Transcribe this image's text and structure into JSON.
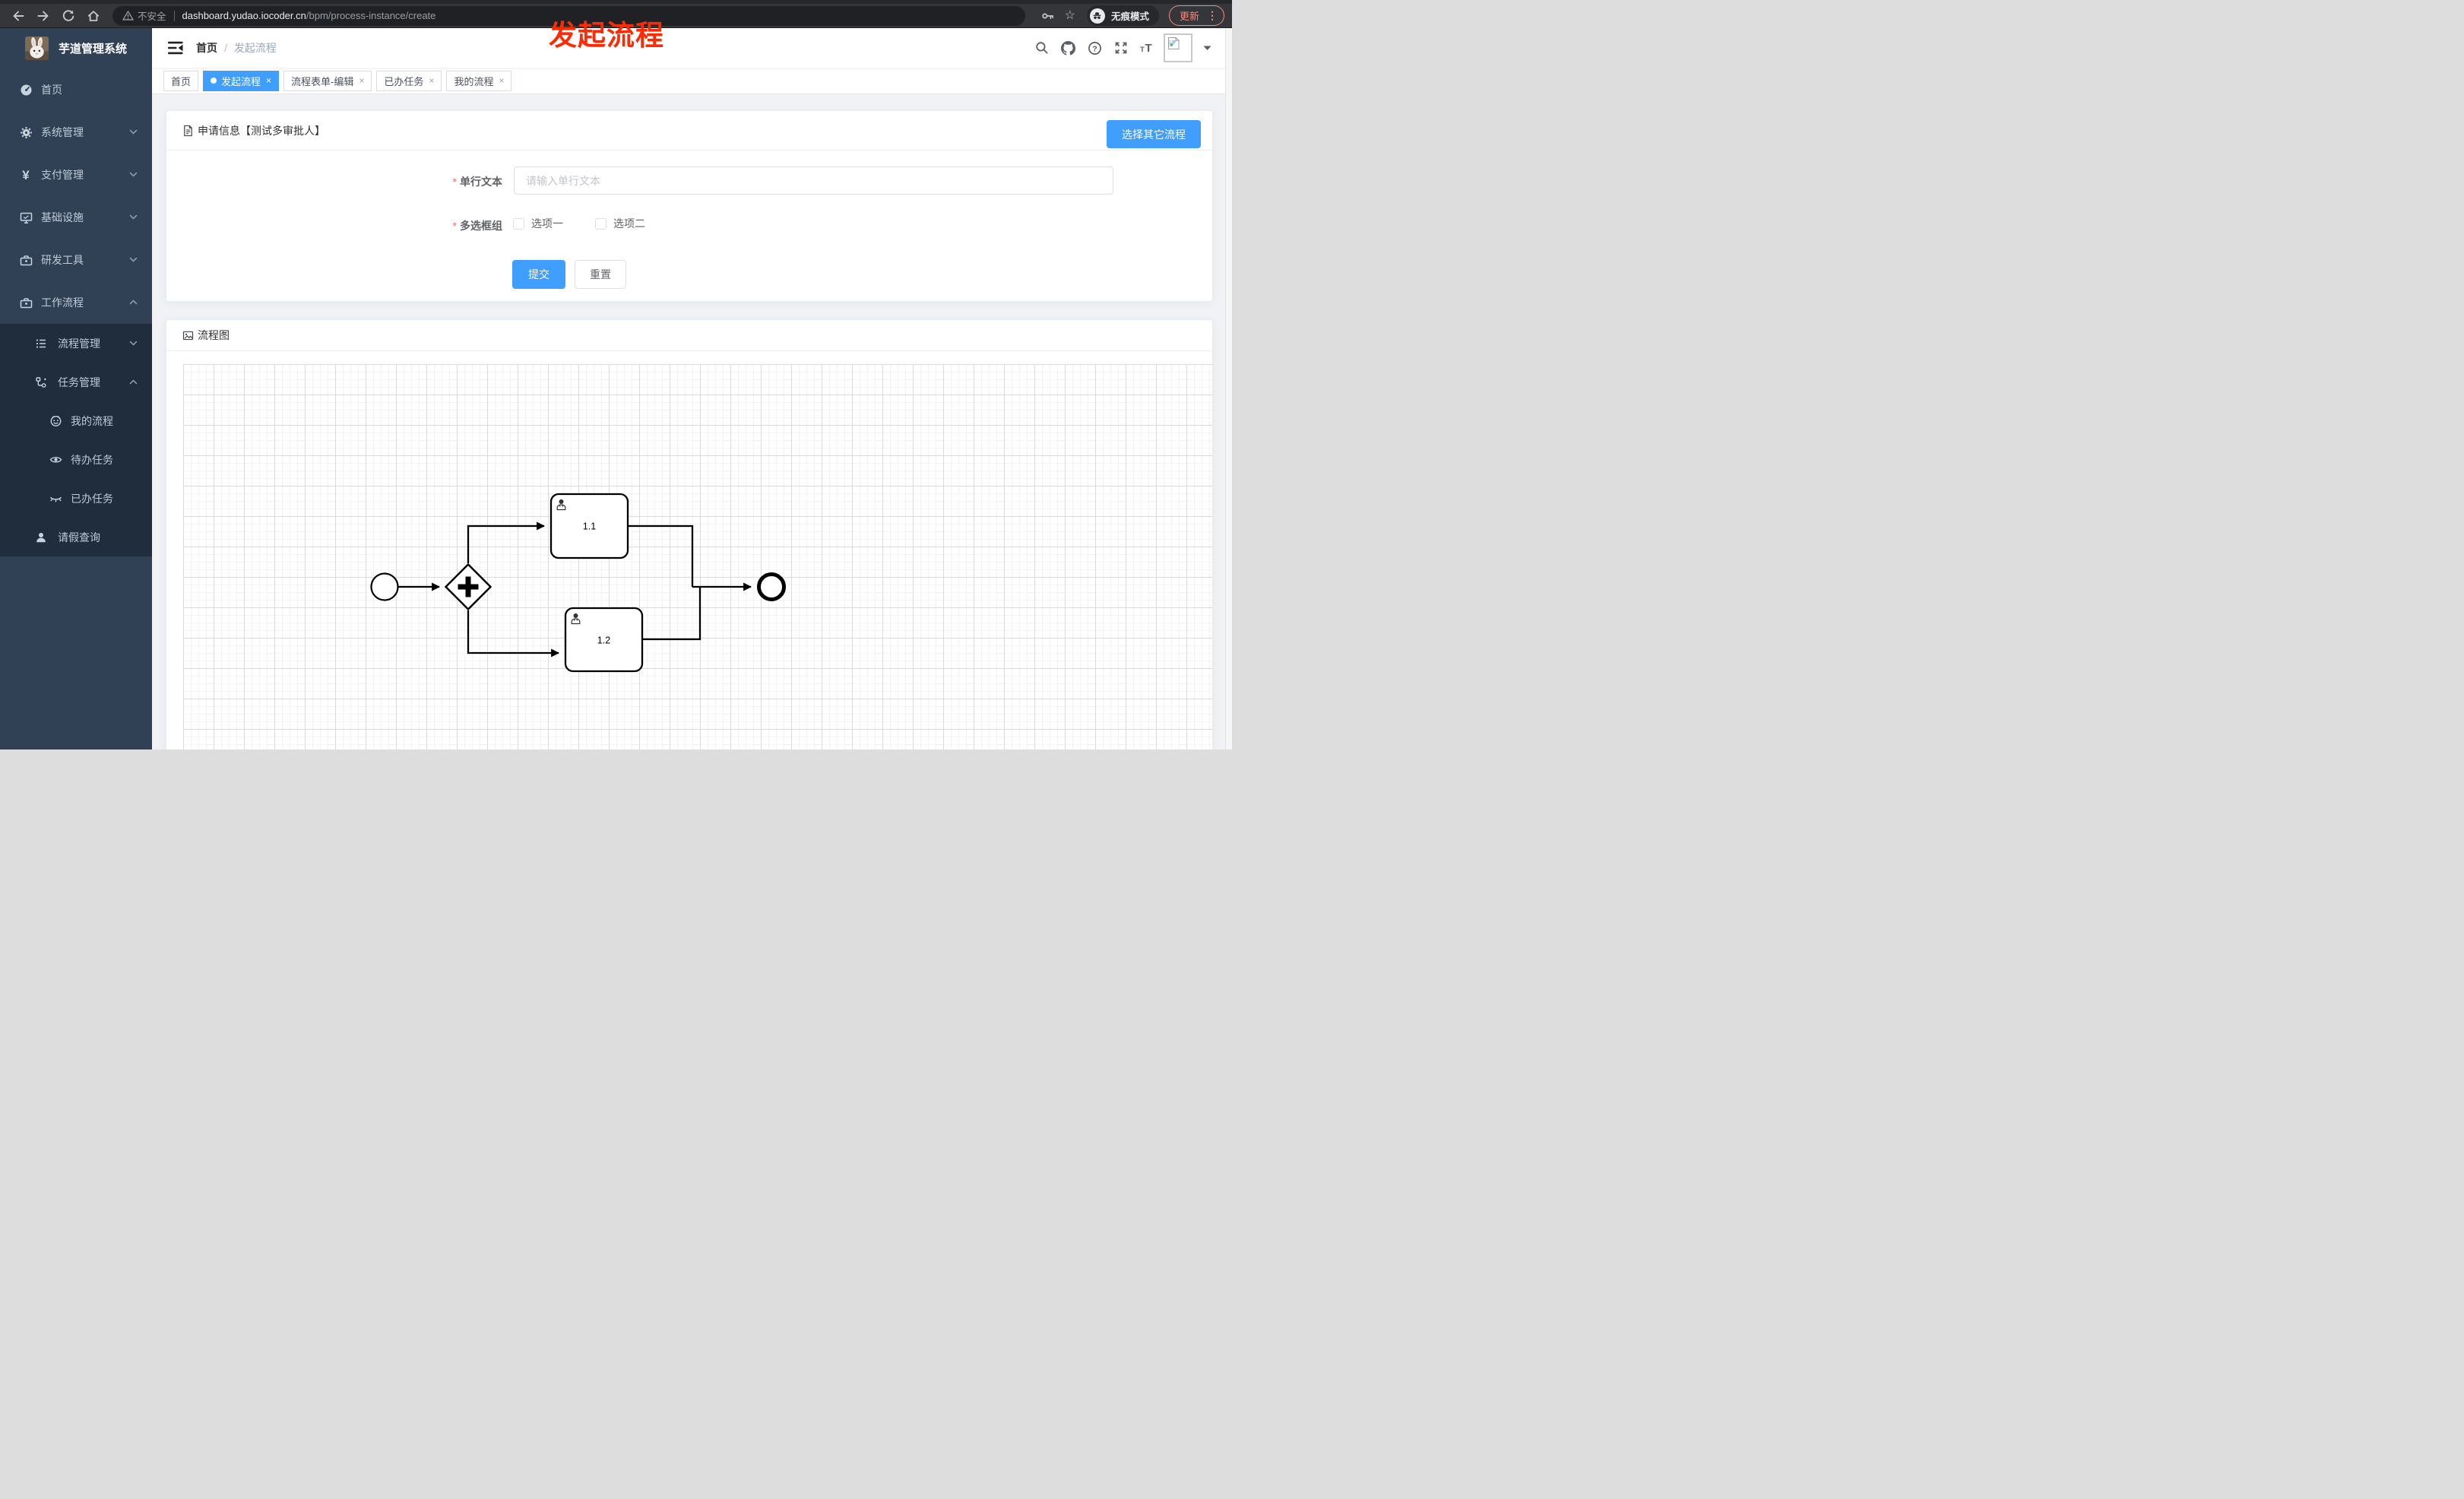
{
  "browser": {
    "security_label": "不安全",
    "url_host": "dashboard.yudao.iocoder.cn",
    "url_path": "/bpm/process-instance/create",
    "incognito_label": "无痕模式",
    "update_label": "更新"
  },
  "glyphs": {
    "close": "×",
    "more_dots": "⋮",
    "star": "☆",
    "yen": "¥"
  },
  "annotation": {
    "text": "发起流程",
    "color": "#fc2b06"
  },
  "sidebar": {
    "title": "芋道管理系统",
    "items": [
      {
        "label": "首页",
        "icon": "dashboard-icon",
        "level": 1
      },
      {
        "label": "系统管理",
        "icon": "gear-icon",
        "level": 1,
        "chevron": "down"
      },
      {
        "label": "支付管理",
        "icon": "yen-icon",
        "level": 1,
        "chevron": "down"
      },
      {
        "label": "基础设施",
        "icon": "monitor-icon",
        "level": 1,
        "chevron": "down"
      },
      {
        "label": "研发工具",
        "icon": "toolbox-icon",
        "level": 1,
        "chevron": "down"
      },
      {
        "label": "工作流程",
        "icon": "toolbox-icon",
        "level": 1,
        "chevron": "up",
        "expanded": true
      },
      {
        "label": "流程管理",
        "icon": "tree-icon",
        "level": 2,
        "chevron": "down"
      },
      {
        "label": "任务管理",
        "icon": "flow-icon",
        "level": 2,
        "chevron": "up",
        "expanded": true
      },
      {
        "label": "我的流程",
        "icon": "face-icon",
        "level": 3
      },
      {
        "label": "待办任务",
        "icon": "eye-icon",
        "level": 3
      },
      {
        "label": "已办任务",
        "icon": "eye-closed-icon",
        "level": 3
      },
      {
        "label": "请假查询",
        "icon": "user-icon",
        "level": 2
      }
    ]
  },
  "navbar": {
    "breadcrumb": [
      "首页",
      "发起流程"
    ]
  },
  "tags": [
    {
      "label": "首页",
      "active": false,
      "closable": false
    },
    {
      "label": "发起流程",
      "active": true,
      "closable": true
    },
    {
      "label": "流程表单-编辑",
      "active": false,
      "closable": true
    },
    {
      "label": "已办任务",
      "active": false,
      "closable": true
    },
    {
      "label": "我的流程",
      "active": false,
      "closable": true
    }
  ],
  "form_card": {
    "title": "申请信息【测试多审批人】",
    "choose_other_label": "选择其它流程",
    "text_field": {
      "label": "单行文本",
      "required": true,
      "placeholder": "请输入单行文本",
      "value": ""
    },
    "checkbox_field": {
      "label": "多选框组",
      "required": true,
      "options": [
        "选项一",
        "选项二"
      ],
      "checked": [
        false,
        false
      ]
    },
    "submit_label": "提交",
    "reset_label": "重置"
  },
  "diagram_card": {
    "title": "流程图",
    "nodes": [
      {
        "type": "start-event",
        "label": ""
      },
      {
        "type": "parallel-gateway",
        "label": ""
      },
      {
        "type": "user-task",
        "label": "1.1"
      },
      {
        "type": "user-task",
        "label": "1.2"
      },
      {
        "type": "end-event",
        "label": ""
      }
    ]
  },
  "colors": {
    "primary": "#409eff",
    "sidebar_bg": "#304156",
    "sidebar_submenu_bg": "#1f2d3d",
    "annotation_red": "#fc2b06",
    "update_pill": "#f28b82"
  }
}
